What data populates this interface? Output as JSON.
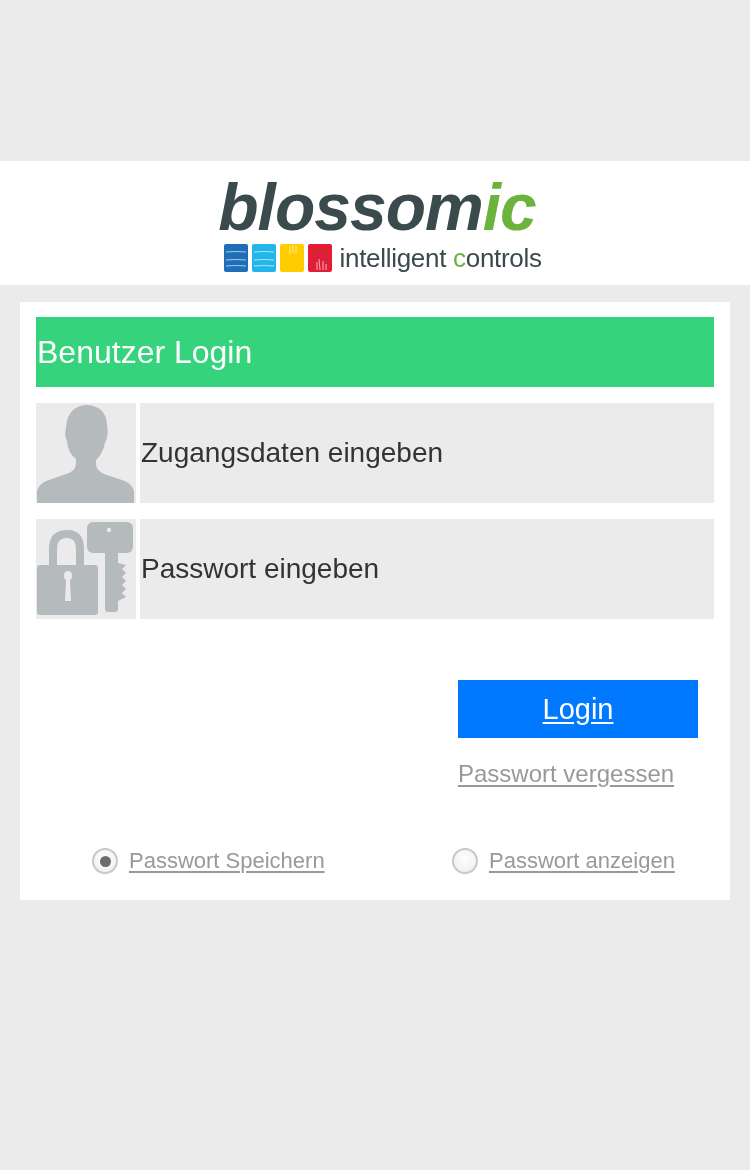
{
  "header": {
    "logo": {
      "wordmark": "blossom",
      "wordmark_accent": "ic",
      "tagline": "intelligent controls"
    }
  },
  "login_panel": {
    "title": "Benutzer Login",
    "fields": [
      {
        "kind": "user",
        "placeholder": "Zugangsdaten eingeben"
      },
      {
        "kind": "password",
        "placeholder": "Passwort eingeben"
      }
    ],
    "login_button": "Login",
    "forgot_password_link": "Passwort vergessen",
    "options": [
      {
        "label": "Passwort Speichern",
        "checked": true
      },
      {
        "label": "Passwort anzeigen",
        "checked": false
      }
    ]
  }
}
